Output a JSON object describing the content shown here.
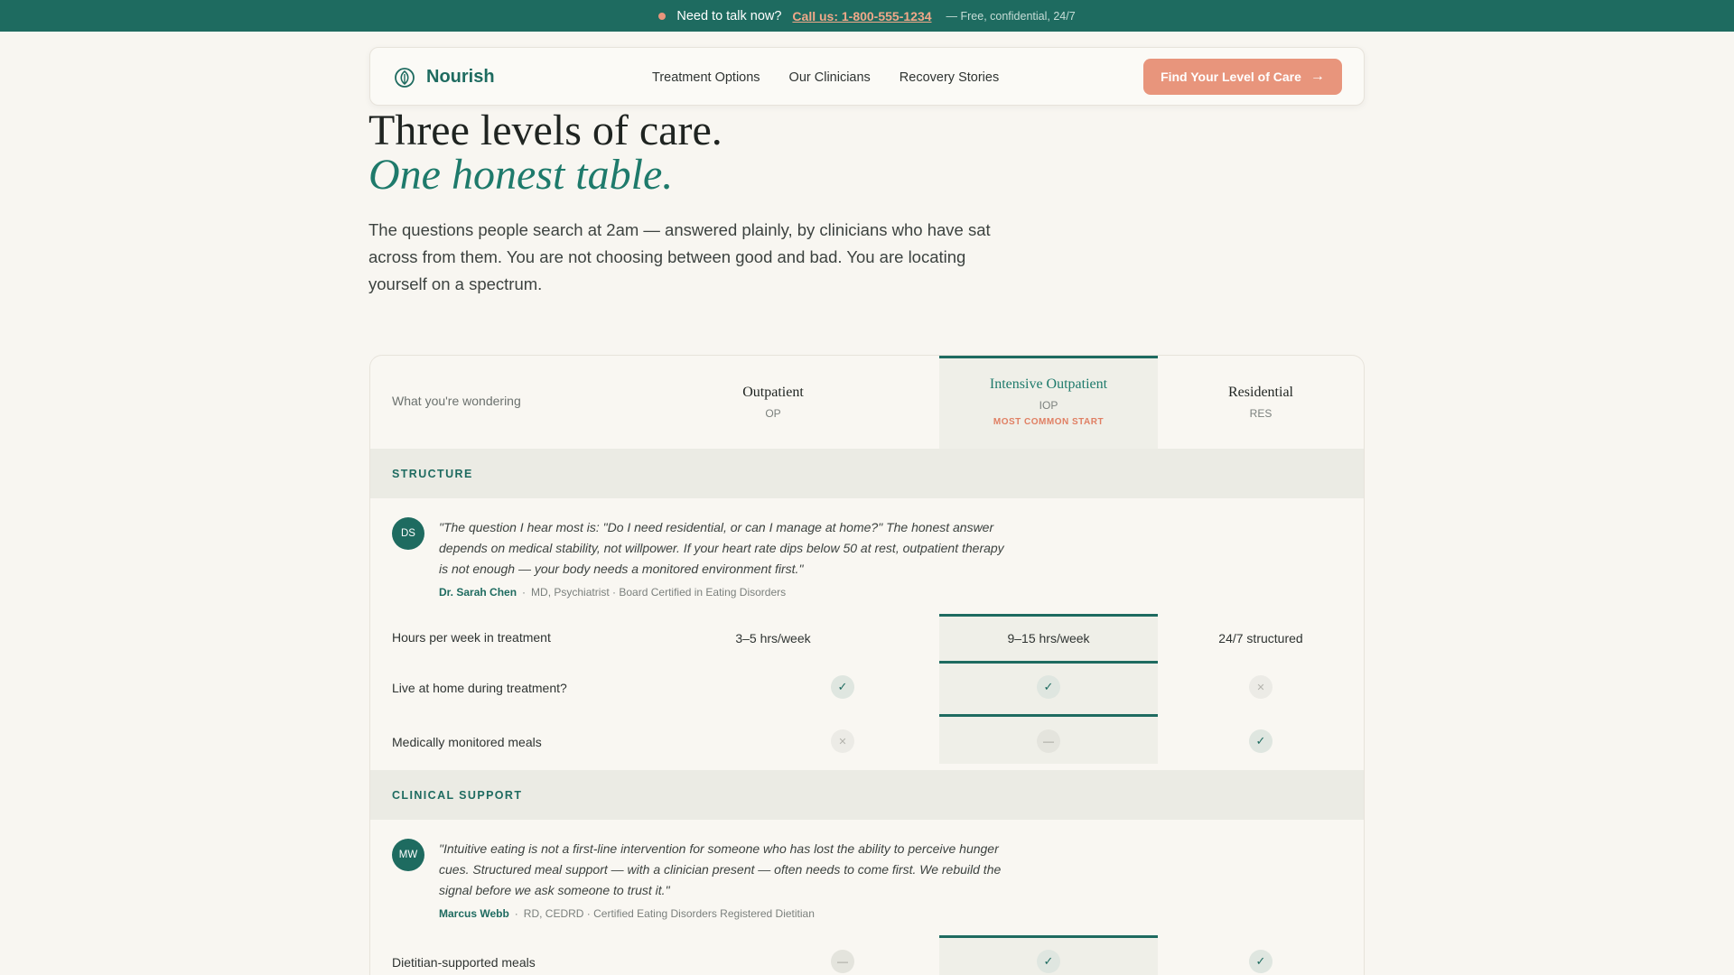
{
  "banner": {
    "prompt": "Need to talk now?",
    "call_label": "Call us: 1-800-555-1234",
    "note": "— Free, confidential, 24/7"
  },
  "nav": {
    "brand": "Nourish",
    "links": [
      "Treatment Options",
      "Our Clinicians",
      "Recovery Stories"
    ],
    "cta_label": "Find Your Level of Care",
    "cta_icon": "arrow-right-icon"
  },
  "hero": {
    "title": "Three levels of care.",
    "subtitle": "One honest table.",
    "description": "The questions people search at 2am — answered plainly, by clinicians who have sat across from them. You are not choosing between good and bad. You are locating yourself on a spectrum."
  },
  "table": {
    "header_question": "What you're wondering",
    "columns": [
      {
        "name": "Outpatient",
        "abbr": "OP",
        "badge": ""
      },
      {
        "name": "Intensive Outpatient",
        "abbr": "IOP",
        "badge": "MOST COMMON START"
      },
      {
        "name": "Residential",
        "abbr": "RES",
        "badge": ""
      }
    ],
    "sections": [
      {
        "label": "STRUCTURE",
        "quote": {
          "initials": "DS",
          "text": "\"The question I hear most is: \"Do I need residential, or can I manage at home?\" The honest answer depends on medical stability, not willpower. If your heart rate dips below 50 at rest, outpatient therapy is not enough — your body needs a monitored environment first.\"",
          "author": "Dr. Sarah Chen",
          "credentials": "MD, Psychiatrist · Board Certified in Eating Disorders"
        },
        "rows": [
          {
            "label": "Hours per week in treatment",
            "values": [
              "3–5 hrs/week",
              "9–15 hrs/week",
              "24/7 structured"
            ]
          },
          {
            "label": "Live at home during treatment?",
            "values": [
              "yes",
              "yes",
              "no"
            ]
          },
          {
            "label": "Medically monitored meals",
            "values": [
              "no",
              "partial",
              "yes"
            ]
          }
        ]
      },
      {
        "label": "CLINICAL SUPPORT",
        "quote": {
          "initials": "MW",
          "text": "\"Intuitive eating is not a first-line intervention for someone who has lost the ability to perceive hunger cues. Structured meal support — with a clinician present — often needs to come first. We rebuild the signal before we ask someone to trust it.\"",
          "author": "Marcus Webb",
          "credentials": "RD, CEDRD · Certified Eating Disorders Registered Dietitian"
        },
        "rows": [
          {
            "label": "Dietitian-supported meals",
            "values": [
              "partial",
              "yes",
              "yes"
            ]
          }
        ]
      }
    ]
  },
  "colors": {
    "brand": "#1e6b60",
    "accent": "#e8957c",
    "background": "#f8f6f1"
  },
  "icons": {
    "yes": "check-icon",
    "no": "x-icon",
    "partial": "dash-icon"
  }
}
